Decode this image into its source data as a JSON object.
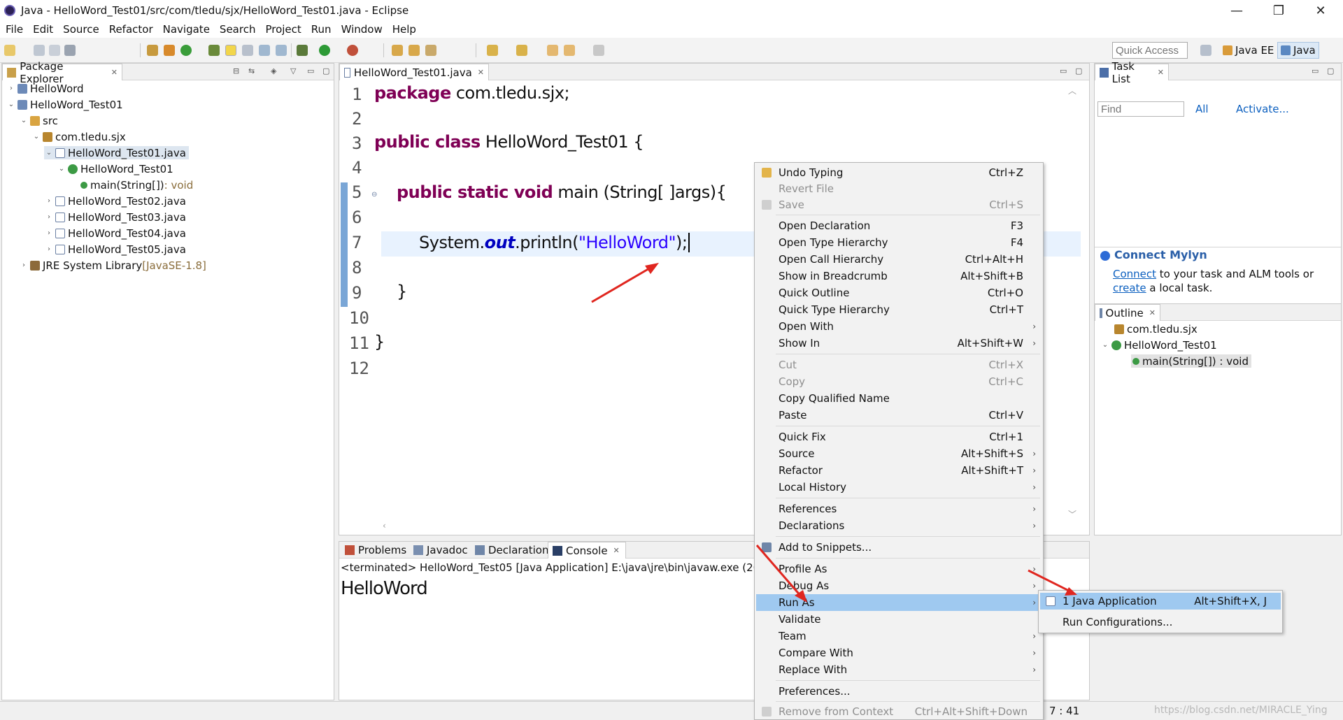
{
  "window": {
    "title": "Java - HelloWord_Test01/src/com/tledu/sjx/HelloWord_Test01.java - Eclipse",
    "minimize": "—",
    "maximize": "❐",
    "close": "✕"
  },
  "menubar": [
    "File",
    "Edit",
    "Source",
    "Refactor",
    "Navigate",
    "Search",
    "Project",
    "Run",
    "Window",
    "Help"
  ],
  "toolbar": {
    "quick_access": "Quick Access",
    "perspectives": [
      "Java EE",
      "Java"
    ]
  },
  "package_explorer": {
    "tab": "Package Explorer",
    "tree": [
      {
        "label": "HelloWord",
        "twisty": "›"
      },
      {
        "label": "HelloWord_Test01",
        "twisty": "⌄"
      },
      {
        "label": "src",
        "twisty": "⌄"
      },
      {
        "label": "com.tledu.sjx",
        "twisty": "⌄"
      },
      {
        "label": "HelloWord_Test01.java",
        "twisty": "⌄"
      },
      {
        "label": "HelloWord_Test01",
        "twisty": "⌄"
      },
      {
        "label": "main(String[])",
        "suffix": " : void",
        "twisty": ""
      },
      {
        "label": "HelloWord_Test02.java",
        "twisty": "›"
      },
      {
        "label": "HelloWord_Test03.java",
        "twisty": "›"
      },
      {
        "label": "HelloWord_Test04.java",
        "twisty": "›"
      },
      {
        "label": "HelloWord_Test05.java",
        "twisty": "›"
      },
      {
        "label": "JRE System Library",
        "suffix": " [JavaSE-1.8]",
        "twisty": "›"
      }
    ]
  },
  "editor": {
    "tab": "HelloWord_Test01.java",
    "line_numbers": [
      "1",
      "2",
      "3",
      "4",
      "5",
      "6",
      "7",
      "8",
      "9",
      "10",
      "11",
      "12"
    ],
    "code": {
      "l1_kw": "package",
      "l1_rest": " com.tledu.sjx;",
      "l3_kw": "public class",
      "l3_rest": " HelloWord_Test01 {",
      "l5_kw": "public static void",
      "l5_rest": " main (String[ ]args){",
      "l7_a": "System.",
      "l7_field": "out",
      "l7_b": ".println(",
      "l7_str": "\"HelloWord\"",
      "l7_c": ");",
      "l9": "}",
      "l11": "}"
    }
  },
  "task_list": {
    "tab": "Task List",
    "find_placeholder": "Find",
    "all": "All",
    "activate": "Activate..."
  },
  "mylyn": {
    "title": "Connect Mylyn",
    "connect": "Connect",
    "text1": " to your task and ALM tools or",
    "create": "create",
    "text2": " a local task."
  },
  "outline": {
    "tab": "Outline",
    "items": [
      "com.tledu.sjx",
      "HelloWord_Test01",
      "main(String[]) : void"
    ]
  },
  "bottom_tabs": [
    "Problems",
    "Javadoc",
    "Declaration",
    "Console"
  ],
  "console": {
    "header": "<terminated> HelloWord_Test05 [Java Application] E:\\java\\jre\\bin\\javaw.exe (202",
    "output": "HelloWord"
  },
  "context_menu": [
    {
      "label": "Undo Typing",
      "key": "Ctrl+Z",
      "disabled": false
    },
    {
      "label": "Revert File",
      "key": "",
      "disabled": true
    },
    {
      "label": "Save",
      "key": "Ctrl+S",
      "disabled": true
    },
    {
      "label": "Open Declaration",
      "key": "F3"
    },
    {
      "label": "Open Type Hierarchy",
      "key": "F4"
    },
    {
      "label": "Open Call Hierarchy",
      "key": "Ctrl+Alt+H"
    },
    {
      "label": "Show in Breadcrumb",
      "key": "Alt+Shift+B"
    },
    {
      "label": "Quick Outline",
      "key": "Ctrl+O"
    },
    {
      "label": "Quick Type Hierarchy",
      "key": "Ctrl+T"
    },
    {
      "label": "Open With",
      "key": ""
    },
    {
      "label": "Show In",
      "key": "Alt+Shift+W"
    },
    {
      "label": "Cut",
      "key": "Ctrl+X",
      "disabled": true
    },
    {
      "label": "Copy",
      "key": "Ctrl+C",
      "disabled": true
    },
    {
      "label": "Copy Qualified Name",
      "key": ""
    },
    {
      "label": "Paste",
      "key": "Ctrl+V"
    },
    {
      "label": "Quick Fix",
      "key": "Ctrl+1"
    },
    {
      "label": "Source",
      "key": "Alt+Shift+S"
    },
    {
      "label": "Refactor",
      "key": "Alt+Shift+T"
    },
    {
      "label": "Local History",
      "key": ""
    },
    {
      "label": "References",
      "key": ""
    },
    {
      "label": "Declarations",
      "key": ""
    },
    {
      "label": "Add to Snippets...",
      "key": ""
    },
    {
      "label": "Profile As",
      "key": ""
    },
    {
      "label": "Debug As",
      "key": ""
    },
    {
      "label": "Run As",
      "key": ""
    },
    {
      "label": "Validate",
      "key": ""
    },
    {
      "label": "Team",
      "key": ""
    },
    {
      "label": "Compare With",
      "key": ""
    },
    {
      "label": "Replace With",
      "key": ""
    },
    {
      "label": "Preferences...",
      "key": ""
    },
    {
      "label": "Remove from Context",
      "key": "Ctrl+Alt+Shift+Down",
      "disabled": true
    }
  ],
  "run_as_submenu": [
    {
      "label": "1 Java Application",
      "key": "Alt+Shift+X, J"
    },
    {
      "label": "Run Configurations...",
      "key": ""
    }
  ],
  "status": {
    "position": "7 : 41",
    "watermark": "https://blog.csdn.net/MIRACLE_Ying"
  },
  "colors": {
    "keyword": "#7f0055",
    "string": "#2a00ff",
    "selection": "#9fc9f0",
    "link": "#0b5fbf",
    "annotation_arrow": "#e0261f"
  }
}
